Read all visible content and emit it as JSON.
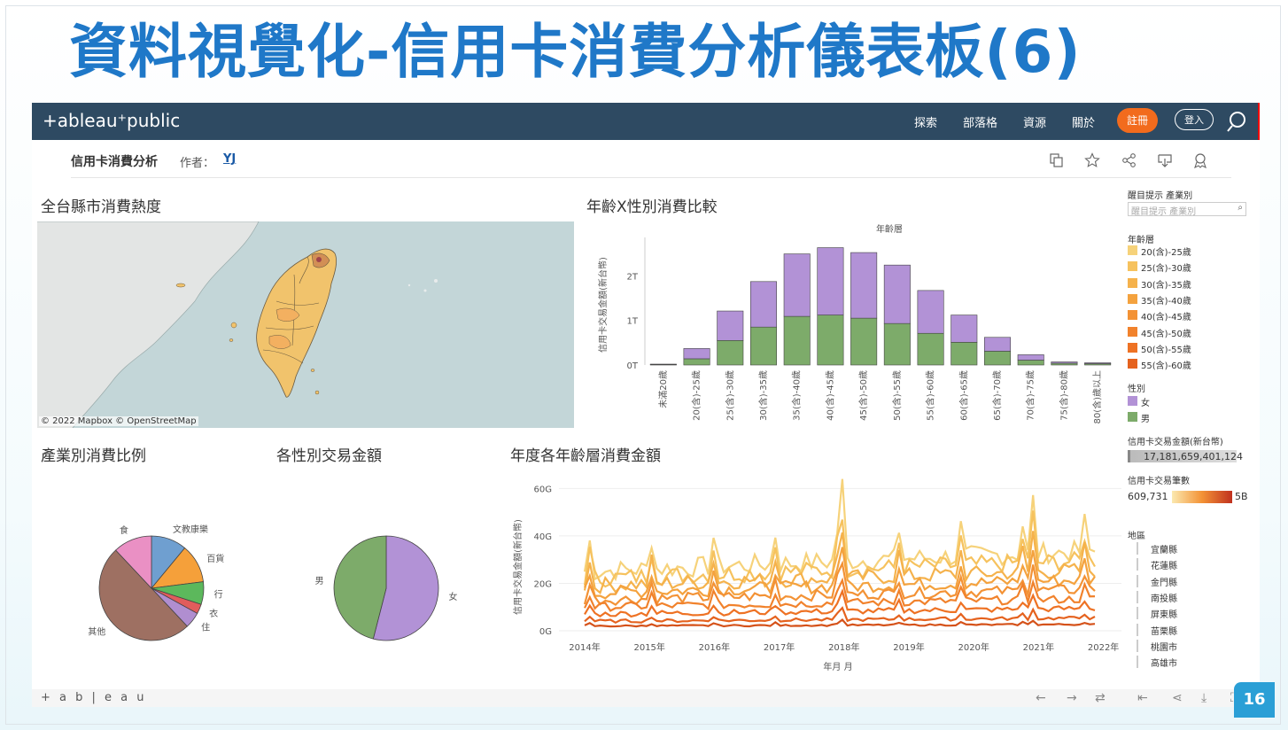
{
  "slide": {
    "title": "資料視覺化-信用卡消費分析儀表板(6)",
    "page_number": "16"
  },
  "topnav": {
    "logo": "+ableau⁺public",
    "items": [
      "探索",
      "部落格",
      "資源",
      "關於"
    ],
    "register": "註冊",
    "login": "登入",
    "icons": [
      "search-icon"
    ]
  },
  "subbar": {
    "title": "信用卡消費分析",
    "author_label": "作者：",
    "author": "YJ",
    "icons": [
      "copy-icon",
      "star-icon",
      "share-icon",
      "download-icon",
      "badge-icon"
    ]
  },
  "sections": {
    "map_title": "全台縣市消費熱度",
    "bar_title": "年齡X性別消費比較",
    "pie1_title": "產業別消費比例",
    "pie2_title": "各性別交易金額",
    "line_title": "年度各年齡層消費金額"
  },
  "map": {
    "credit": "© 2022 Mapbox  © OpenStreetMap"
  },
  "chart_data": [
    {
      "type": "bar",
      "title": "年齡層",
      "ylabel": "信用卡交易金額(新台幣)",
      "yticks": [
        "0T",
        "1T",
        "2T"
      ],
      "ylim": [
        0,
        2.7
      ],
      "categories": [
        "未滿20歲",
        "20(含)-25歲",
        "25(含)-30歲",
        "30(含)-35歲",
        "35(含)-40歲",
        "40(含)-45歲",
        "45(含)-50歲",
        "50(含)-55歲",
        "55(含)-60歲",
        "60(含)-65歲",
        "65(含)-70歲",
        "70(含)-75歲",
        "75(含)-80歲",
        "80(含)歲以上"
      ],
      "series": [
        {
          "name": "男",
          "color": "#7dab6a",
          "values": [
            0.01,
            0.14,
            0.55,
            0.85,
            1.09,
            1.12,
            1.05,
            0.93,
            0.71,
            0.51,
            0.31,
            0.11,
            0.04,
            0.03
          ]
        },
        {
          "name": "女",
          "color": "#b292d6",
          "values": [
            0.01,
            0.23,
            0.66,
            1.02,
            1.4,
            1.51,
            1.47,
            1.31,
            0.96,
            0.61,
            0.31,
            0.12,
            0.03,
            0.02
          ]
        }
      ]
    },
    {
      "type": "pie",
      "title": "產業別消費比例",
      "labels": [
        "文教康樂",
        "百貨",
        "行",
        "衣",
        "住",
        "其他",
        "食"
      ],
      "values": [
        11,
        12,
        7,
        3,
        5,
        50,
        12
      ],
      "colors": [
        "#6f9fd0",
        "#f5a03a",
        "#5cb85c",
        "#e05c5c",
        "#b08ed0",
        "#9e7062",
        "#ea90c4"
      ]
    },
    {
      "type": "pie",
      "title": "各性別交易金額",
      "labels": [
        "女",
        "男"
      ],
      "values": [
        54,
        46
      ],
      "colors": [
        "#b292d6",
        "#7dab6a"
      ]
    },
    {
      "type": "line",
      "title": "年度各年齡層消費金額",
      "ylabel": "信用卡交易金額(新台幣)",
      "xlabel": "年月 月",
      "xticks": [
        "2014年",
        "2015年",
        "2016年",
        "2017年",
        "2018年",
        "2019年",
        "2020年",
        "2021年",
        "2022年"
      ],
      "yticks": [
        "0G",
        "20G",
        "40G",
        "60G"
      ],
      "ylim": [
        0,
        65
      ],
      "series_base_levels": [
        25,
        22,
        19,
        16,
        13,
        10,
        7,
        4,
        2
      ]
    }
  ],
  "right_panel": {
    "filter_label": "醒目提示 產業別",
    "filter_placeholder": "醒目提示 產業別",
    "age_label": "年齡層",
    "age_legend": [
      {
        "name": "20(含)-25歲",
        "color": "#f6d27a"
      },
      {
        "name": "25(含)-30歲",
        "color": "#f6c25e"
      },
      {
        "name": "30(含)-35歲",
        "color": "#f5b24c"
      },
      {
        "name": "35(含)-40歲",
        "color": "#f4a23e"
      },
      {
        "name": "40(含)-45歲",
        "color": "#f39235"
      },
      {
        "name": "45(含)-50歲",
        "color": "#f1822c"
      },
      {
        "name": "50(含)-55歲",
        "color": "#ee7224"
      },
      {
        "name": "55(含)-60歲",
        "color": "#e5621e"
      }
    ],
    "gender_label": "性別",
    "gender_legend": [
      {
        "name": "女",
        "color": "#b292d6"
      },
      {
        "name": "男",
        "color": "#7dab6a"
      }
    ],
    "amount_label": "信用卡交易金額(新台幣)",
    "amount_value": "17,181,659,401,124",
    "count_label": "信用卡交易筆數",
    "count_min": "609,731",
    "count_max": "5B",
    "region_label": "地區",
    "regions": [
      "宜蘭縣",
      "花蓮縣",
      "金門縣",
      "南投縣",
      "屏東縣",
      "苗栗縣",
      "桃園市",
      "高雄市"
    ]
  },
  "footer": {
    "logo": "+ a b | e a u"
  }
}
